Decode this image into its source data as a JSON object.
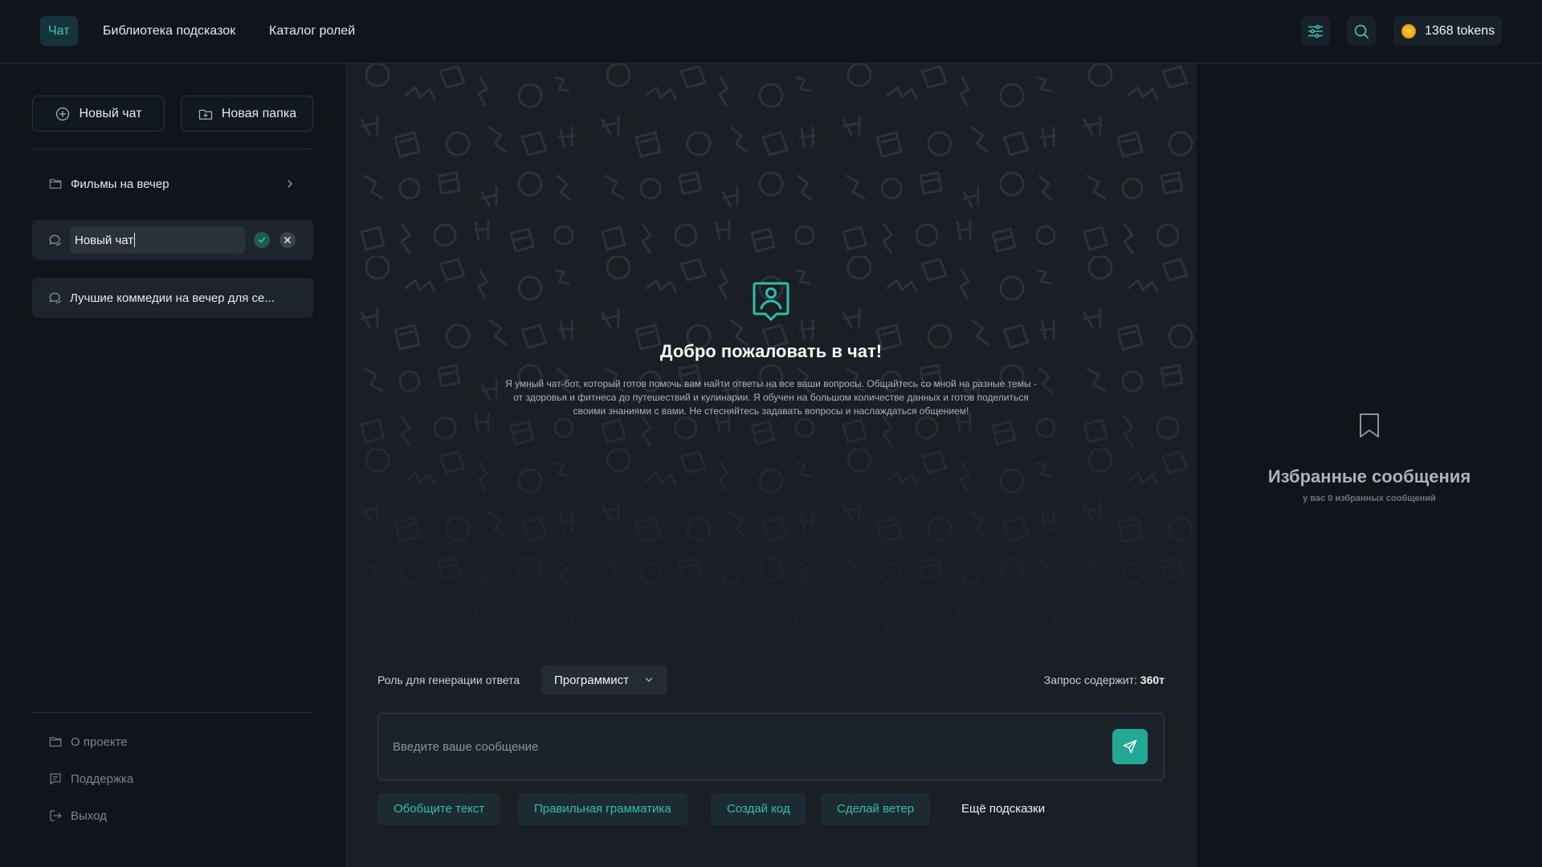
{
  "header": {
    "tabs": [
      {
        "label": "Чат",
        "active": true
      },
      {
        "label": "Библиотека подсказок",
        "active": false
      },
      {
        "label": "Каталог ролей",
        "active": false
      }
    ],
    "tokens_label": "1368 tokens",
    "icons": [
      "settings-sliders-icon",
      "search-icon",
      "coin-icon"
    ]
  },
  "sidebar": {
    "new_chat_label": "Новый чат",
    "new_folder_label": "Новая папка",
    "folders": [
      {
        "label": "Фильмы на вечер"
      }
    ],
    "chats": [
      {
        "label": "Новый чат",
        "editing": true
      },
      {
        "label": "Лучшие коммедии на вечер для се..."
      }
    ],
    "footer": [
      {
        "label": "О проекте",
        "icon": "folder-icon"
      },
      {
        "label": "Поддержка",
        "icon": "support-icon"
      },
      {
        "label": "Выход",
        "icon": "logout-icon"
      }
    ]
  },
  "main": {
    "welcome_title": "Добро пожаловать в чат!",
    "welcome_text": "Я умный чат-бот, который готов помочь вам найти ответы на все ваши вопросы. Общайтесь со мной на разные темы - от здоровья и фитнеса до путешествий и кулинарии. Я обучен на большом количестве данных и готов поделиться своими знаниями с вами. Не стесняйтесь задавать вопросы и наслаждаться общением!",
    "role_label": "Роль для генерации ответа",
    "role_value": "Программист",
    "request_prefix": "Запрос содержит:",
    "request_value": "360т",
    "input_placeholder": "Введите ваше сообщение",
    "chips": [
      {
        "label": "Обобщите текст"
      },
      {
        "label": "Правильная грамматика"
      },
      {
        "label": "Создай код"
      },
      {
        "label": "Сделай ветер"
      }
    ],
    "more_label": "Ещё  подсказки"
  },
  "favorites": {
    "title": "Избранные сообщения",
    "subtitle": "у вас 0 избранных сообщений"
  },
  "colors": {
    "accent": "#22a894",
    "accent_text": "#2fbfa9",
    "background": "#10151c",
    "main_background": "#1a1f26"
  }
}
